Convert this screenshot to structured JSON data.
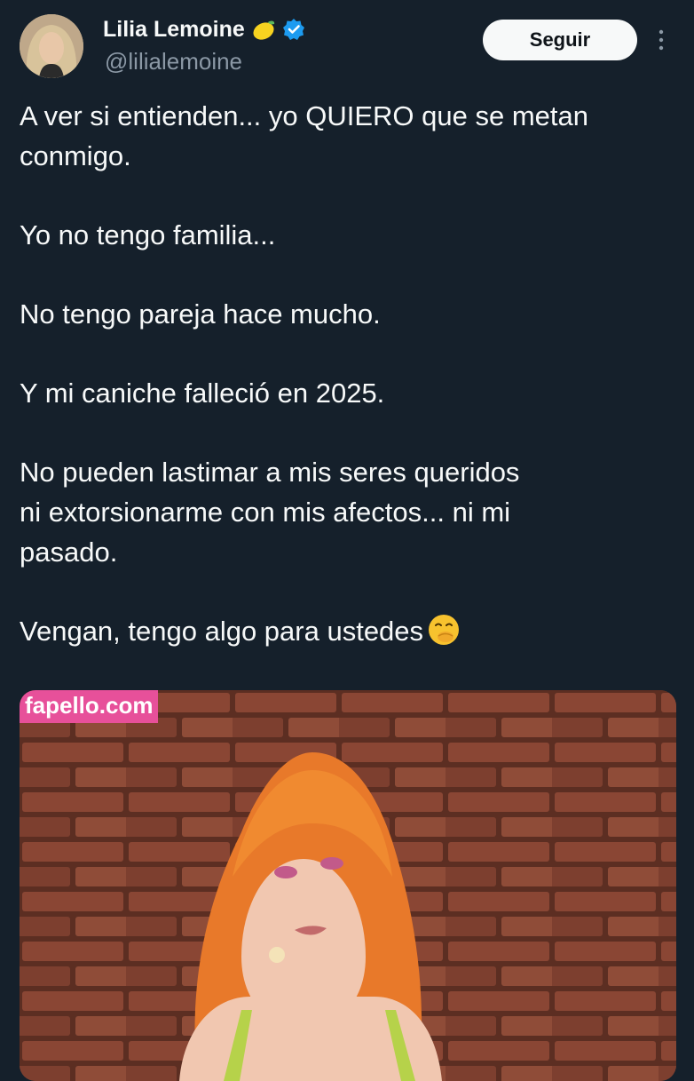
{
  "author": {
    "display_name": "Lilia Lemoine",
    "handle": "@lilialemoine",
    "name_emoji": "lemon-emoji",
    "verified": true
  },
  "actions": {
    "follow_label": "Seguir",
    "more_icon": "more-vertical-icon"
  },
  "tweet": {
    "paragraphs": [
      "A ver si entienden... yo QUIERO que se metan\nconmigo.",
      "Yo no tengo familia...",
      "No tengo pareja hace mucho.",
      "Y mi caniche falleció en 2025.",
      "No pueden lastimar a mis seres queridos\nni extorsionarme con mis afectos... ni mi\npasado.",
      "Vengan, tengo algo para ustedes"
    ],
    "last_emoji": "face-with-hand-over-mouth-emoji"
  },
  "media": {
    "watermark": "fapello.com"
  },
  "colors": {
    "background": "#15202b",
    "text": "#f7f9f9",
    "muted": "#8b98a5",
    "verified": "#1d9bf0",
    "watermark_bg": "#e7509a"
  }
}
